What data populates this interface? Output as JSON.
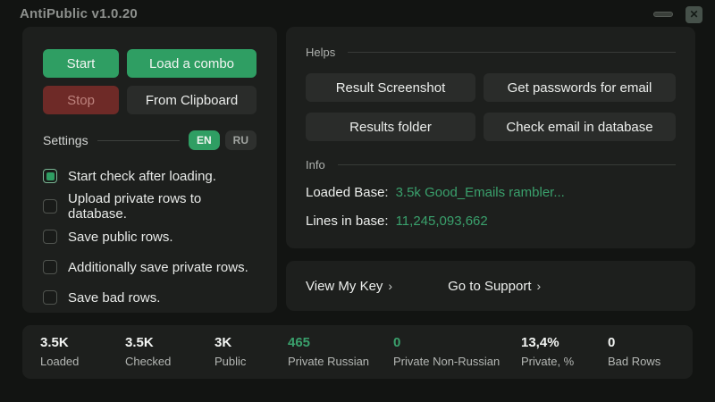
{
  "window": {
    "title": "AntiPublic v1.0.20",
    "close_glyph": "✕"
  },
  "left_panel": {
    "buttons": {
      "start": "Start",
      "load_combo": "Load a combo",
      "stop": "Stop",
      "from_clipboard": "From Clipboard"
    },
    "settings": {
      "label": "Settings",
      "lang_en": "EN",
      "lang_ru": "RU"
    },
    "checkboxes": [
      {
        "label": "Start check after loading.",
        "checked": true
      },
      {
        "label": "Upload private rows to database.",
        "checked": false
      },
      {
        "label": "Save public rows.",
        "checked": false
      },
      {
        "label": "Additionally save private rows.",
        "checked": false
      },
      {
        "label": "Save bad rows.",
        "checked": false
      }
    ]
  },
  "helps": {
    "label": "Helps",
    "buttons": [
      "Result Screenshot",
      "Get passwords for email",
      "Results folder",
      "Check email in database"
    ]
  },
  "info": {
    "label": "Info",
    "loaded_base_label": "Loaded Base:",
    "loaded_base_value": "3.5k Good_Emails rambler...",
    "lines_label": "Lines in base:",
    "lines_value": "11,245,093,662"
  },
  "links": {
    "view_key": "View My Key",
    "support": "Go to Support",
    "chevron": "›"
  },
  "stats": [
    {
      "value": "3.5K",
      "label": "Loaded",
      "green": false
    },
    {
      "value": "3.5K",
      "label": "Checked",
      "green": false
    },
    {
      "value": "3K",
      "label": "Public",
      "green": false
    },
    {
      "value": "465",
      "label": "Private Russian",
      "green": true
    },
    {
      "value": "0",
      "label": "Private Non-Russian",
      "green": true
    },
    {
      "value": "13,4%",
      "label": "Private, %",
      "green": false
    },
    {
      "value": "0",
      "label": "Bad Rows",
      "green": false
    }
  ],
  "colors": {
    "accent_green": "#2f9e63",
    "green_text": "#3aa06c",
    "stop_red": "#6e2a27",
    "panel_bg": "#1d1f1d",
    "window_bg": "#121412"
  }
}
